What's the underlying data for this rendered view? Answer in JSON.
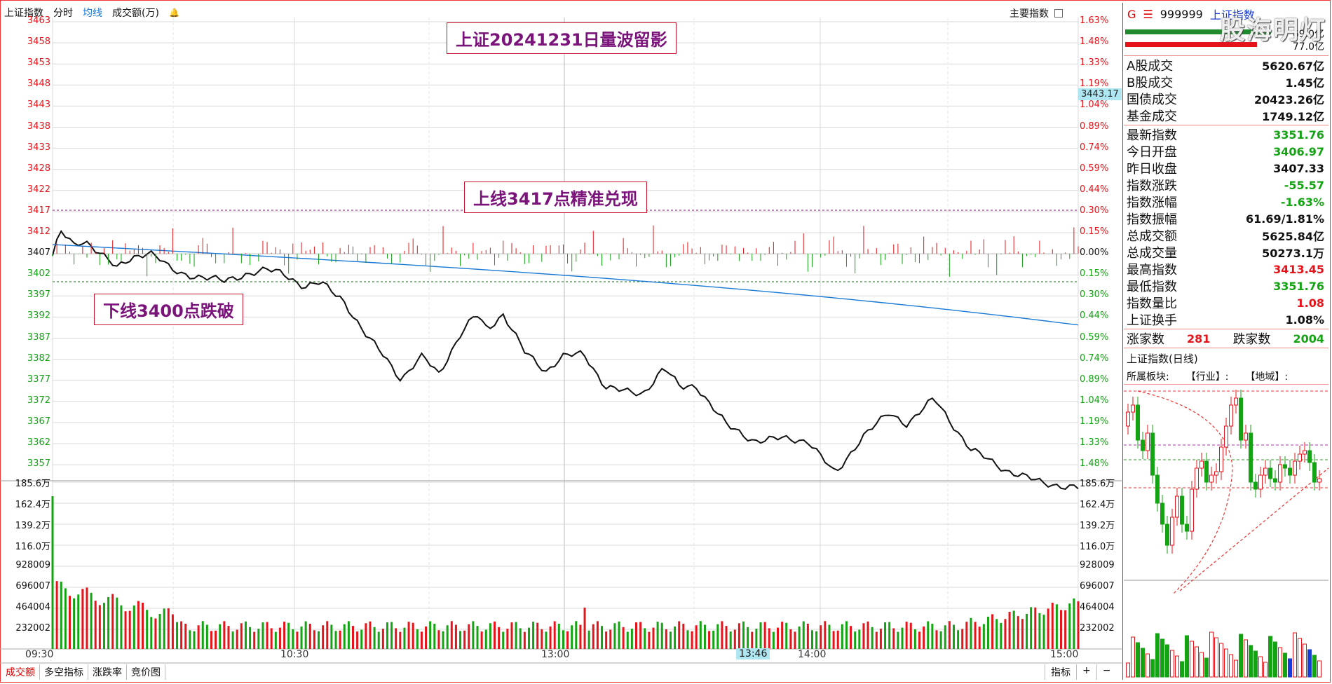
{
  "header": {
    "index_name": "上证指数",
    "mode_tabs": [
      "分时",
      "均线",
      "成交额(万)"
    ],
    "main_index_label": "主要指数"
  },
  "axis": {
    "price_left": [
      "3463",
      "3458",
      "3453",
      "3448",
      "3443",
      "3438",
      "3433",
      "3428",
      "3422",
      "3417",
      "3412",
      "3407",
      "3402",
      "3397",
      "3392",
      "3387",
      "3382",
      "3377",
      "3372",
      "3367",
      "3362",
      "3357"
    ],
    "pct_right": [
      "1.63%",
      "1.48%",
      "1.33%",
      "1.19%",
      "1.04%",
      "0.89%",
      "0.74%",
      "0.59%",
      "0.44%",
      "0.30%",
      "0.15%",
      "0.00%",
      "0.15%",
      "0.30%",
      "0.44%",
      "0.59%",
      "0.74%",
      "0.89%",
      "1.04%",
      "1.19%",
      "1.33%",
      "1.48%"
    ],
    "pct_colors": [
      "#e5141a",
      "#e5141a",
      "#e5141a",
      "#e5141a",
      "#e5141a",
      "#e5141a",
      "#e5141a",
      "#e5141a",
      "#e5141a",
      "#e5141a",
      "#e5141a",
      "#111111",
      "#13a313",
      "#13a313",
      "#13a313",
      "#13a313",
      "#13a313",
      "#13a313",
      "#13a313",
      "#13a313",
      "#13a313",
      "#13a313"
    ],
    "volume_left": [
      "185.6万",
      "162.4万",
      "139.2万",
      "116.0万",
      "928009",
      "696007",
      "464004",
      "232002"
    ],
    "volume_right": [
      "185.6万",
      "162.4万",
      "139.2万",
      "116.0万",
      "928009",
      "696007",
      "464004",
      "232002"
    ],
    "times": [
      "09:30",
      "10:30",
      "13:00",
      "14:00",
      "15:00"
    ],
    "cursor_time": "13:46",
    "cursor_price": "3443.17"
  },
  "banners": {
    "title": "上证20241231日量波留影",
    "upper": "上线3417点精准兑现",
    "lower": "下线3400点跌破"
  },
  "bottom_tabs": [
    "成交额",
    "多空指标",
    "涨跌率",
    "竞价图"
  ],
  "bottom_right": [
    "指标",
    "+",
    "−"
  ],
  "right_panel": {
    "g_label": "G",
    "code": "999999",
    "name": "上证指数",
    "bar_vals": [
      "69.0亿",
      "77.0亿"
    ],
    "turnover": [
      {
        "label": "A股成交",
        "value": "5620.67亿"
      },
      {
        "label": "B股成交",
        "value": "1.45亿"
      },
      {
        "label": "国债成交",
        "value": "20423.26亿"
      },
      {
        "label": "基金成交",
        "value": "1749.12亿"
      }
    ],
    "stats": [
      {
        "label": "最新指数",
        "value": "3351.76",
        "color": "#13a313"
      },
      {
        "label": "今日开盘",
        "value": "3406.97",
        "color": "#13a313"
      },
      {
        "label": "昨日收盘",
        "value": "3407.33",
        "color": "#111111"
      },
      {
        "label": "指数涨跌",
        "value": "-55.57",
        "color": "#13a313"
      },
      {
        "label": "指数涨幅",
        "value": "-1.63%",
        "color": "#13a313"
      },
      {
        "label": "指数振幅",
        "value": "61.69/1.81%",
        "color": "#111111"
      },
      {
        "label": "总成交额",
        "value": "5625.84亿",
        "color": "#111111"
      },
      {
        "label": "总成交量",
        "value": "50273.1万",
        "color": "#111111"
      },
      {
        "label": "最高指数",
        "value": "3413.45",
        "color": "#e5141a"
      },
      {
        "label": "最低指数",
        "value": "3351.76",
        "color": "#13a313"
      },
      {
        "label": "指数量比",
        "value": "1.08",
        "color": "#e5141a"
      },
      {
        "label": "上证换手",
        "value": "1.08%",
        "color": "#111111"
      }
    ],
    "breadth": {
      "up_label": "涨家数",
      "up_value": "281",
      "down_label": "跌家数",
      "down_value": "2004"
    },
    "daily_title": "上证指数(日线)",
    "daily_tags": [
      "所属板块:",
      "【行业】:",
      "【地域】:"
    ]
  },
  "watermark": "股海明灯",
  "colors": {
    "up": "#e5141a",
    "down": "#13a313",
    "price_line": "#111111",
    "avg_line": "#1a7ad6",
    "grid": "#d9d9d9"
  }
}
